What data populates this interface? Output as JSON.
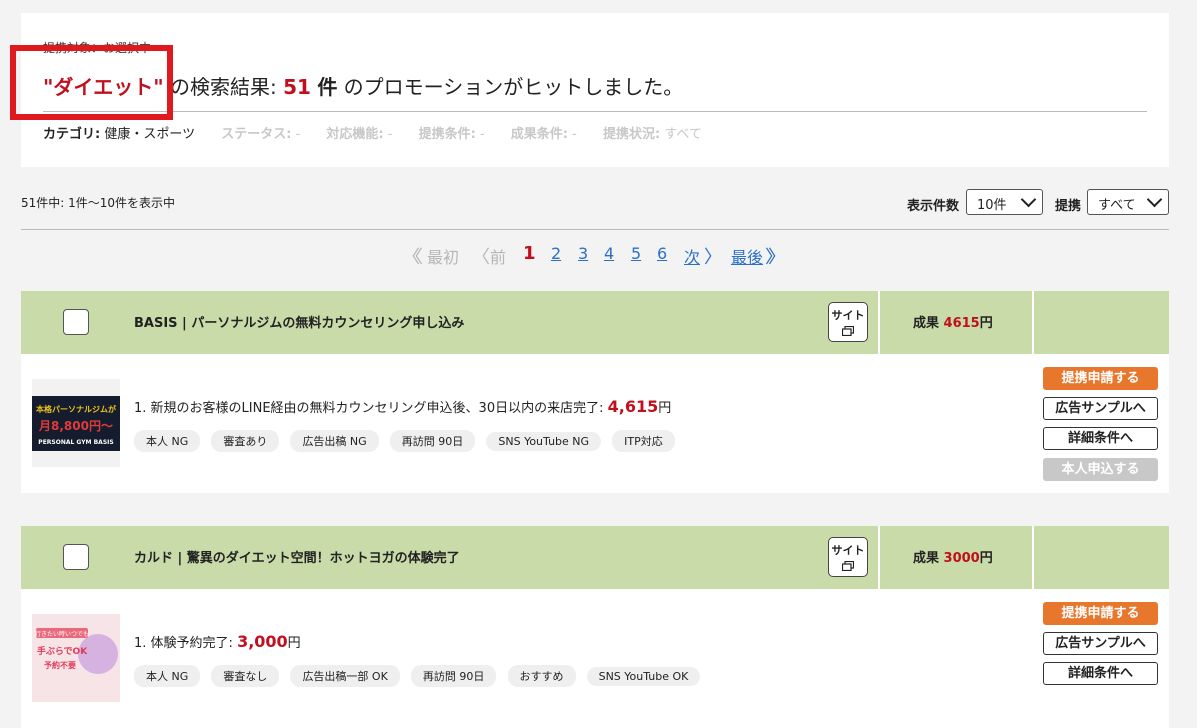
{
  "header": {
    "breadcrumb": "提携対象：お選択中",
    "keyword": "\"ダイエット\"",
    "result_prefix": "の検索結果:",
    "result_count": "51",
    "result_unit": "件",
    "result_suffix": "のプロモーションがヒットしました。",
    "filters": [
      {
        "label": "カテゴリ:",
        "value": "健康・スポーツ",
        "active": true
      },
      {
        "label": "ステータス:",
        "value": "-",
        "active": false
      },
      {
        "label": "対応機能:",
        "value": "-",
        "active": false
      },
      {
        "label": "提携条件:",
        "value": "-",
        "active": false
      },
      {
        "label": "成果条件:",
        "value": "-",
        "active": false
      },
      {
        "label": "提携状況:",
        "value": "すべて",
        "active": false
      }
    ]
  },
  "controls": {
    "showing_text": "51件中: 1件〜10件を表示中",
    "per_page_label": "表示件数",
    "per_page_value": "10件",
    "partner_label": "提携",
    "partner_value": "すべて"
  },
  "pager": {
    "first": "最初",
    "prev": "前",
    "current": "1",
    "pages": [
      "2",
      "3",
      "4",
      "5",
      "6"
    ],
    "next": "次",
    "last": "最後"
  },
  "promotions": [
    {
      "title": "BASIS | パーソナルジムの無料カウンセリング申し込み",
      "site_label": "サイト",
      "reward_label": "成果",
      "reward_amount": "4615",
      "reward_unit": "円",
      "condition": "1. 新規のお客様のLINE経由の無料カウンセリング申込後、30日以内の来店完了:",
      "condition_amount": "4,615",
      "condition_unit": "円",
      "tags": [
        "本人 NG",
        "審査あり",
        "広告出稿 NG",
        "再訪問 90日",
        "SNS YouTube NG",
        "ITP対応"
      ],
      "thumb_text1": "本格パーソナルジムが",
      "thumb_text2": "月8,800円〜",
      "thumb_text3": "PERSONAL GYM BASIS",
      "buttons": [
        "提携申請する",
        "広告サンプルへ",
        "詳細条件へ",
        "本人申込する"
      ]
    },
    {
      "title": "カルド | 驚異のダイエット空間！ホットヨガの体験完了",
      "site_label": "サイト",
      "reward_label": "成果",
      "reward_amount": "3000",
      "reward_unit": "円",
      "condition": "1. 体験予約完了:",
      "condition_amount": "3,000",
      "condition_unit": "円",
      "tags": [
        "本人 NG",
        "審査なし",
        "広告出稿一部 OK",
        "再訪問 90日",
        "おすすめ",
        "SNS YouTube OK"
      ],
      "thumb_text1": "行きたい時いつでも",
      "thumb_text2": "手ぶらでOK",
      "thumb_text3": "予約不要",
      "buttons": [
        "提携申請する",
        "広告サンプルへ",
        "詳細条件へ"
      ]
    }
  ],
  "colors": {
    "accent_red": "#c0101d",
    "header_green": "#c8dba8",
    "orange_btn": "#e8772e",
    "link_blue": "#2c70c8",
    "highlight_red": "#e0191e"
  }
}
